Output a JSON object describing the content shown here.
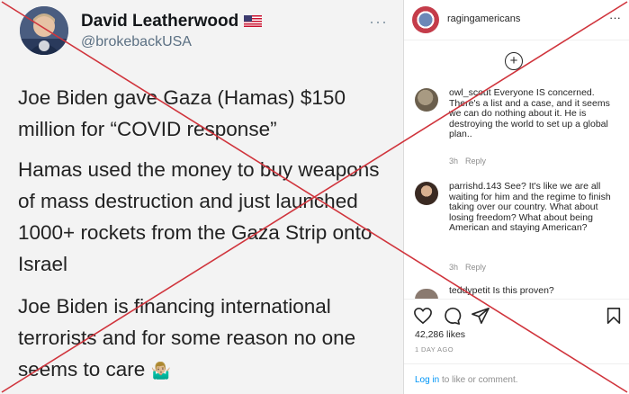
{
  "tweet": {
    "name": "David Leatherwood",
    "flag_emoji": "us-flag",
    "handle": "@brokebackUSA",
    "more": "···",
    "paragraph1": "Joe Biden gave Gaza (Hamas) $150 million for “COVID response”",
    "paragraph2": "Hamas used the money to buy weapons of mass destruction and just launched 1000+ rockets from the Gaza Strip onto Israel",
    "paragraph3": "Joe Biden is financing international terrorists and for some reason no one seems to care",
    "paragraph3_emoji": "🤷🏼‍♂️"
  },
  "instagram": {
    "username": "ragingamericans",
    "more": "···",
    "load_more": "+",
    "comments": [
      {
        "user": "owl_scout",
        "text": "Everyone IS concerned. There's a list and a case, and it seems we can do nothing about it. He is destroying the world to set up a global plan..",
        "time": "3h",
        "reply": "Reply"
      },
      {
        "user": "parrishd.143",
        "text": "See? It's like we are all waiting for him and the regime to finish taking over our country. What about losing freedom? What about being American and staying American?",
        "time": "3h",
        "reply": "Reply"
      },
      {
        "user": "teddypetit",
        "text": "Is this proven?",
        "time": "",
        "reply": ""
      }
    ],
    "likes": "42,286 likes",
    "posted": "1 DAY AGO",
    "login_link": "Log in",
    "login_rest": " to like or comment."
  },
  "colors": {
    "x_mark": "#d0343c",
    "ig_link": "#0095f6"
  }
}
